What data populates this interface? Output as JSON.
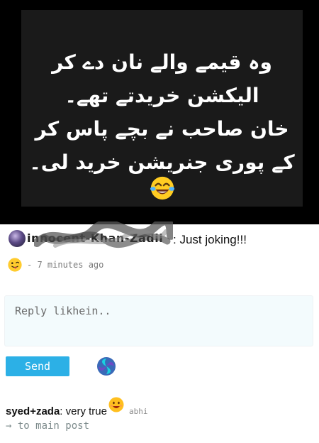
{
  "post": {
    "urdu_lines": [
      "وہ قیمے والے نان دے کر",
      "الیکشن خریدتے تھے۔",
      "خان صاحب نے بچے پاس کر",
      "کے پوری جنریشن خرید لی۔"
    ],
    "emoji_icon": "laughing-tears-emoji"
  },
  "comment": {
    "username": "innocent-Khan-Zadii",
    "text": ": Just joking!!!",
    "emoji_icon": "tongue-out-emoji",
    "time": "- 7 minutes ago"
  },
  "reply_form": {
    "placeholder": "Reply likhein..",
    "send_label": "Send",
    "icon": "swirl-loader-icon"
  },
  "reply": {
    "user": "syed+zada",
    "text": ": very true",
    "emoji_icon": "grinning-emoji",
    "author": "abhi"
  },
  "main_post_link": "→ to main post",
  "colors": {
    "image_bg": "#000000",
    "send_button": "#2cb0e6",
    "reply_box_bg": "#f3fbfd",
    "link": "#7e8c8d"
  }
}
